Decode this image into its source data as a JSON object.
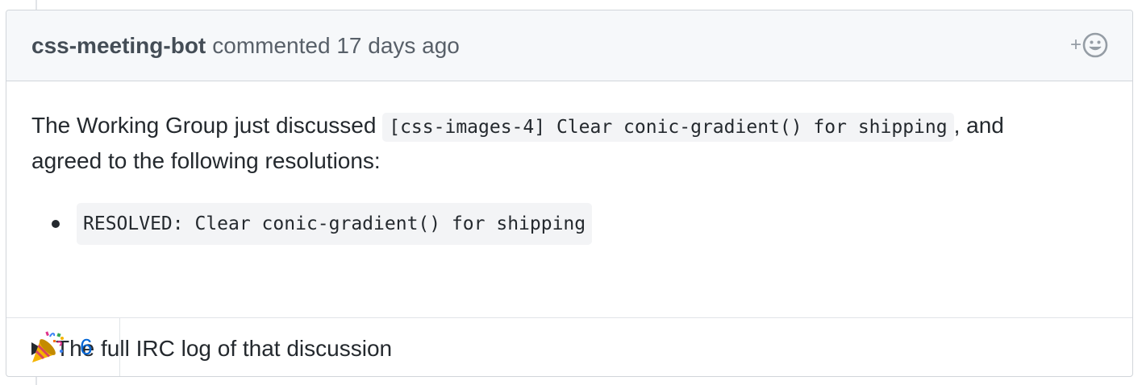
{
  "comment": {
    "author": "css-meeting-bot",
    "meta": "commented 17 days ago",
    "add_reaction_label": "+",
    "body": {
      "intro_before": "The Working Group just discussed ",
      "issue_code": "[css-images-4] Clear conic-gradient() for shipping",
      "intro_after": ", and",
      "intro_line2": "agreed to the following resolutions:",
      "resolutions": [
        "RESOLVED: Clear conic-gradient() for shipping"
      ],
      "details_summary": "The full IRC log of that discussion"
    },
    "reactions": [
      {
        "icon": "party-popper-icon",
        "count": "6"
      }
    ]
  },
  "colors": {
    "link": "#0366d6",
    "header_bg": "#f6f8fa",
    "border": "#d1d5da"
  }
}
